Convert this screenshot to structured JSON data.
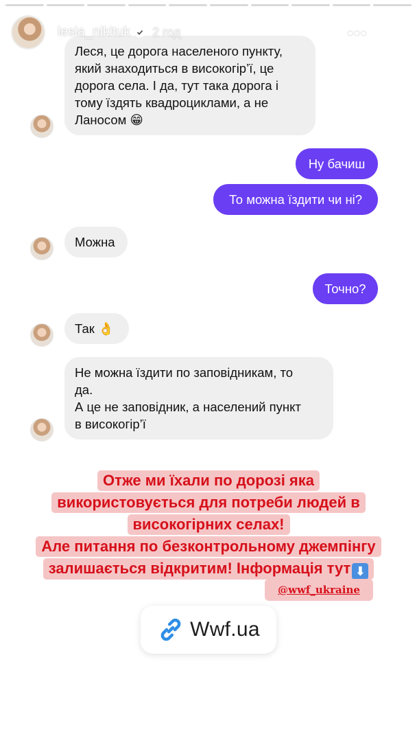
{
  "story": {
    "username": "lesia_nikituk",
    "time": "2 год",
    "progress_segments": 10
  },
  "chat": {
    "messages": [
      {
        "side": "in",
        "text": "Леся, це дорога населеного пункту,\nякий знаходиться в високогір’ї, це\nдорога села. І да, тут така дорога і\nтому їздять квадроциклами, а не\nЛаносом 😁"
      },
      {
        "side": "out",
        "text": "Ну бачиш"
      },
      {
        "side": "out",
        "text": "То можна їздити чи ні?"
      },
      {
        "side": "in",
        "text": "Можна"
      },
      {
        "side": "out",
        "text": "Точно?"
      },
      {
        "side": "in",
        "text": "Так 👌"
      },
      {
        "side": "in",
        "text": "Не можна їздити по заповідникам, то\nда.\nА це не заповідник, а населений пункт\nв високогір’ї"
      }
    ]
  },
  "promo": {
    "lines": [
      "Отже ми їхали по дорозі яка",
      "використовується для потреби людей в",
      "високогірних селах!",
      "Але питання по безконтрольному джемпінгу",
      "залишається відкритим! Інформація тут"
    ]
  },
  "mention": "@wwf_ukraine",
  "link": {
    "label": "Wwf.ua"
  },
  "colors": {
    "outgoing_bubble": "#6a3ef3",
    "incoming_bubble": "#efeff0",
    "promo_text": "#d6101a",
    "promo_highlight": "#f5c5c6"
  }
}
